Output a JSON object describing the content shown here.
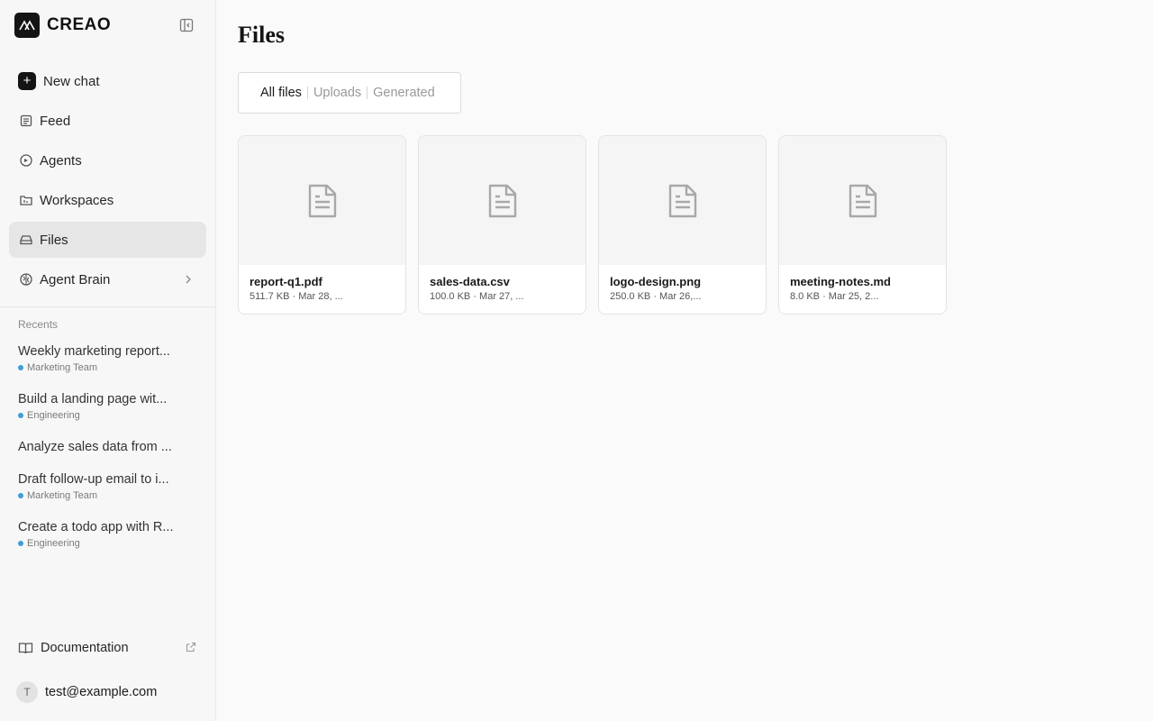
{
  "brand": {
    "name": "CREAO",
    "logo_icon": "creao-logo-icon"
  },
  "sidebar": {
    "collapse_icon": "sidebar-collapse-icon",
    "nav": [
      {
        "label": "New chat",
        "icon": "plus-icon",
        "active": false
      },
      {
        "label": "Feed",
        "icon": "newspaper-icon",
        "active": false
      },
      {
        "label": "Agents",
        "icon": "agent-icon",
        "active": false
      },
      {
        "label": "Workspaces",
        "icon": "workspace-icon",
        "active": false
      },
      {
        "label": "Files",
        "icon": "drive-icon",
        "active": true
      },
      {
        "label": "Agent Brain",
        "icon": "brain-icon",
        "active": false,
        "has_chevron": true
      }
    ],
    "recents_label": "Recents",
    "recents": [
      {
        "title": "Weekly marketing report...",
        "tag": "Marketing Team",
        "tag_color": "#3b9fd8"
      },
      {
        "title": "Build a landing page wit...",
        "tag": "Engineering",
        "tag_color": "#3b9fd8"
      },
      {
        "title": "Analyze sales data from ...",
        "tag": "",
        "tag_color": ""
      },
      {
        "title": "Draft follow-up email to i...",
        "tag": "Marketing Team",
        "tag_color": "#3b9fd8"
      },
      {
        "title": "Create a todo app with R...",
        "tag": "Engineering",
        "tag_color": "#3b9fd8"
      }
    ],
    "docs_label": "Documentation",
    "user": {
      "initial": "T",
      "email": "test@example.com"
    }
  },
  "main": {
    "title": "Files",
    "tabs": [
      {
        "label": "All files",
        "active": true
      },
      {
        "label": "Uploads",
        "active": false
      },
      {
        "label": "Generated",
        "active": false
      }
    ],
    "files": [
      {
        "name": "report-q1.pdf",
        "meta": "511.7 KB · Mar 28, ...",
        "icon": "document-icon"
      },
      {
        "name": "sales-data.csv",
        "meta": "100.0 KB · Mar 27, ...",
        "icon": "document-icon"
      },
      {
        "name": "logo-design.png",
        "meta": "250.0 KB · Mar 26,...",
        "icon": "document-icon"
      },
      {
        "name": "meeting-notes.md",
        "meta": "8.0 KB · Mar 25, 2...",
        "icon": "document-icon"
      }
    ]
  }
}
